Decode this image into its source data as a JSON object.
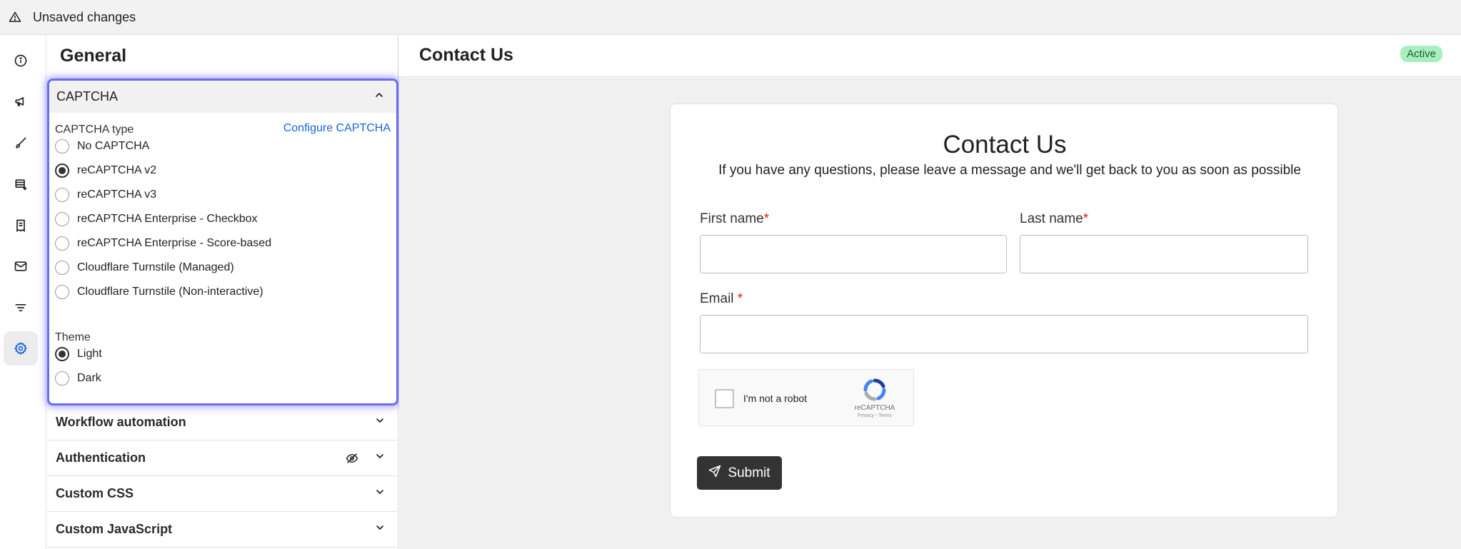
{
  "banner": {
    "text": "Unsaved changes",
    "icon": "warning-triangle-icon"
  },
  "rail": {
    "items": [
      {
        "icon": "info-icon"
      },
      {
        "icon": "megaphone-icon"
      },
      {
        "icon": "brush-icon"
      },
      {
        "icon": "add-table-icon"
      },
      {
        "icon": "receipt-icon"
      },
      {
        "icon": "mail-icon"
      },
      {
        "icon": "filter-icon"
      },
      {
        "icon": "gear-icon",
        "active": true,
        "color": "#1766d6"
      }
    ]
  },
  "panel": {
    "title": "General",
    "captcha": {
      "header": "CAPTCHA",
      "type_label": "CAPTCHA type",
      "configure_link": "Configure CAPTCHA",
      "options": [
        "No CAPTCHA",
        "reCAPTCHA v2",
        "reCAPTCHA v3",
        "reCAPTCHA Enterprise - Checkbox",
        "reCAPTCHA Enterprise - Score-based",
        "Cloudflare Turnstile (Managed)",
        "Cloudflare Turnstile (Non-interactive)"
      ],
      "selected": "reCAPTCHA v2",
      "theme_label": "Theme",
      "themes": [
        "Light",
        "Dark"
      ],
      "selected_theme": "Light"
    },
    "accordions": [
      {
        "label": "Workflow automation"
      },
      {
        "label": "Authentication",
        "icon": "eye-off-icon"
      },
      {
        "label": "Custom CSS"
      },
      {
        "label": "Custom JavaScript"
      }
    ]
  },
  "main": {
    "title": "Contact Us",
    "status": "Active",
    "status_color": "#a8efc0",
    "form": {
      "title": "Contact Us",
      "subtitle": "If you have any questions, please leave a message and we'll get back to you as soon as possible",
      "first_name_label": "First name",
      "last_name_label": "Last name",
      "email_label": "Email ",
      "required_mark": "*",
      "recaptcha": {
        "checkbox_label": "I'm not a robot",
        "brand": "reCAPTCHA",
        "terms": "Privacy - Terms"
      },
      "submit_label": "Submit"
    }
  }
}
